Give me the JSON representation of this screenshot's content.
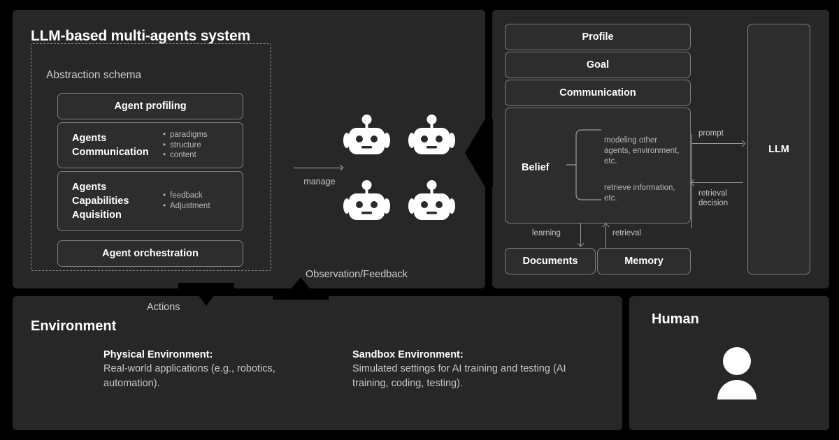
{
  "colors": {
    "background": "#000000",
    "panel": "#272727",
    "box": "#2d2d2d",
    "border": "#7e7e7e",
    "text_primary": "#ffffff",
    "text_secondary": "#c7c7c7",
    "connector": "#9a9a9a"
  },
  "mas_panel": {
    "title": "LLM-based multi-agents system",
    "schema_label": "Abstraction schema",
    "boxes": {
      "profiling": "Agent profiling",
      "communication": {
        "title": "Agents\nCommunication",
        "title_line1": "Agents",
        "title_line2": "Communication",
        "bullets": [
          "paradigms",
          "structure",
          "content"
        ]
      },
      "capabilities": {
        "title_line1": "Agents",
        "title_line2": "Capabilities",
        "title_line3": "Aquisition",
        "bullets": [
          "feedback",
          "Adjustment"
        ]
      },
      "orchestration": "Agent orchestration"
    },
    "manage_label": "manage",
    "agents": [
      {
        "name": "agent-1",
        "icon": "robot-icon"
      },
      {
        "name": "agent-2",
        "icon": "robot-icon"
      },
      {
        "name": "agent-3",
        "icon": "robot-icon"
      },
      {
        "name": "agent-4",
        "icon": "robot-icon"
      }
    ]
  },
  "agent_panel": {
    "profile": "Profile",
    "goal": "Goal",
    "communication": "Communication",
    "belief": "Belief",
    "belief_branches": [
      "modeling other agents, environment, etc.",
      "retrieve information, etc."
    ],
    "documents": "Documents",
    "memory": "Memory",
    "llm": "LLM",
    "edges": {
      "prompt": "prompt",
      "retrieval_decision": "retrieval decision",
      "retrieval_decision_line1": "retrieval",
      "retrieval_decision_line2": "decision",
      "learning": "learning",
      "retrieval": "retrieval"
    }
  },
  "environment_panel": {
    "title": "Environment",
    "columns": [
      {
        "heading": "Physical Environment:",
        "body": "Real-world applications (e.g., robotics, automation)."
      },
      {
        "heading": "Sandbox Environment:",
        "body": "Simulated settings for AI training and testing (AI training, coding, testing)."
      }
    ]
  },
  "human_panel": {
    "title": "Human",
    "icon": "person-icon"
  },
  "flow_labels": {
    "observation_feedback": "Observation/Feedback",
    "actions": "Actions"
  }
}
